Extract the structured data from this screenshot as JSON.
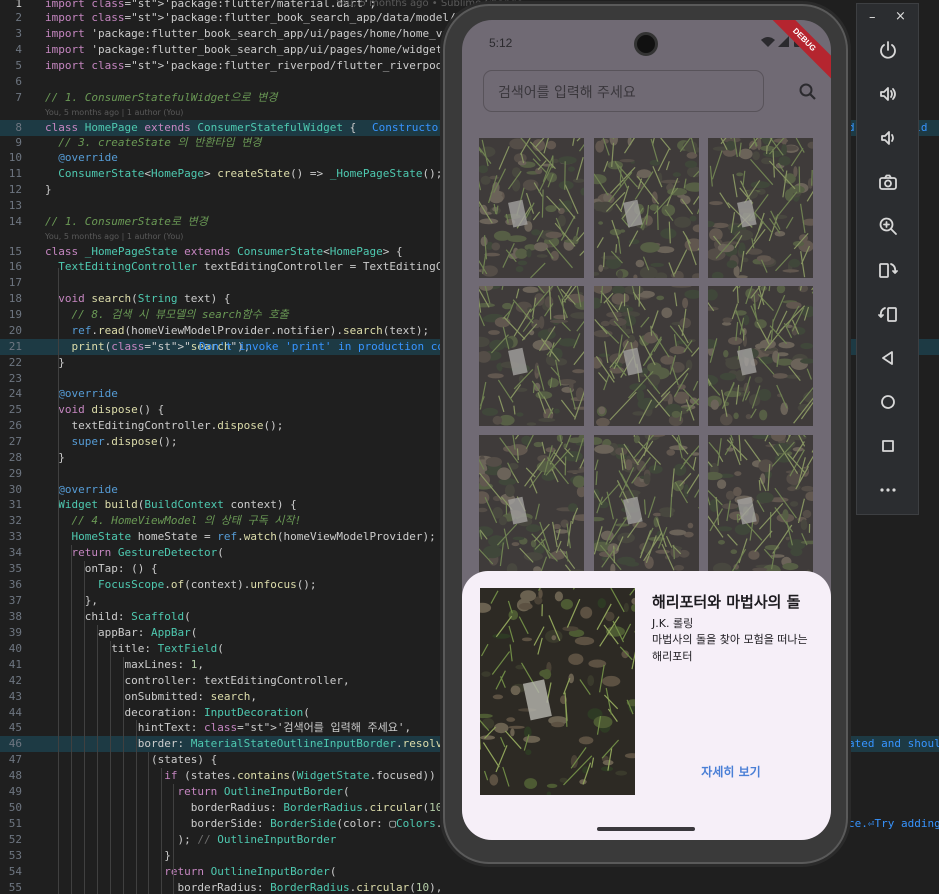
{
  "editor": {
    "blame_top": "You, 5 months ago • Sublime Change",
    "blame_8": "You, 5 months ago | 1 author (You)",
    "blame_15": "You, 5 months ago | 1 author (You)",
    "hint_8": "Constructor",
    "hint_8b": "d and should",
    "hint_21": "Don't invoke 'print' in production cod",
    "hint_46": "ated and should",
    "hint_51": "ce.⏎Try adding",
    "lines": [
      {
        "n": "1",
        "t": "import 'package:flutter/material.dart';"
      },
      {
        "n": "2",
        "t": "import 'package:flutter_book_search_app/data/model/book.dart';"
      },
      {
        "n": "3",
        "t": "import 'package:flutter_book_search_app/ui/pages/home/home_vie"
      },
      {
        "n": "4",
        "t": "import 'package:flutter_book_search_app/ui/pages/home/widgets/"
      },
      {
        "n": "5",
        "t": "import 'package:flutter_riverpod/flutter_riverpod.dart';"
      },
      {
        "n": "6",
        "t": ""
      },
      {
        "n": "7",
        "t": "// 1. ConsumerStatefulWidget으로 변경"
      },
      {
        "n": "8",
        "t": "class HomePage extends ConsumerStatefulWidget {"
      },
      {
        "n": "9",
        "t": "  // 3. createState 의 반환타입 변경"
      },
      {
        "n": "10",
        "t": "  @override"
      },
      {
        "n": "11",
        "t": "  ConsumerState<HomePage> createState() => _HomePageState();"
      },
      {
        "n": "12",
        "t": "}"
      },
      {
        "n": "13",
        "t": ""
      },
      {
        "n": "14",
        "t": "// 1. ConsumerState로 변경"
      },
      {
        "n": "15",
        "t": "class _HomePageState extends ConsumerState<HomePage> {"
      },
      {
        "n": "16",
        "t": "  TextEditingController textEditingController = TextEditingCon"
      },
      {
        "n": "17",
        "t": ""
      },
      {
        "n": "18",
        "t": "  void search(String text) {"
      },
      {
        "n": "19",
        "t": "    // 8. 검색 시 뷰모델의 search함수 호출"
      },
      {
        "n": "20",
        "t": "    ref.read(homeViewModelProvider.notifier).search(text);"
      },
      {
        "n": "21",
        "t": "    print(\"search\");"
      },
      {
        "n": "22",
        "t": "  }"
      },
      {
        "n": "23",
        "t": ""
      },
      {
        "n": "24",
        "t": "  @override"
      },
      {
        "n": "25",
        "t": "  void dispose() {"
      },
      {
        "n": "26",
        "t": "    textEditingController.dispose();"
      },
      {
        "n": "27",
        "t": "    super.dispose();"
      },
      {
        "n": "28",
        "t": "  }"
      },
      {
        "n": "29",
        "t": ""
      },
      {
        "n": "30",
        "t": "  @override"
      },
      {
        "n": "31",
        "t": "  Widget build(BuildContext context) {"
      },
      {
        "n": "32",
        "t": "    // 4. HomeViewModel 의 상태 구독 시작!"
      },
      {
        "n": "33",
        "t": "    HomeState homeState = ref.watch(homeViewModelProvider);"
      },
      {
        "n": "34",
        "t": "    return GestureDetector("
      },
      {
        "n": "35",
        "t": "      onTap: () {"
      },
      {
        "n": "36",
        "t": "        FocusScope.of(context).unfocus();"
      },
      {
        "n": "37",
        "t": "      },"
      },
      {
        "n": "38",
        "t": "      child: Scaffold("
      },
      {
        "n": "39",
        "t": "        appBar: AppBar("
      },
      {
        "n": "40",
        "t": "          title: TextField("
      },
      {
        "n": "41",
        "t": "            maxLines: 1,"
      },
      {
        "n": "42",
        "t": "            controller: textEditingController,"
      },
      {
        "n": "43",
        "t": "            onSubmitted: search,"
      },
      {
        "n": "44",
        "t": "            decoration: InputDecoration("
      },
      {
        "n": "45",
        "t": "              hintText: '검색어를 입력해 주세요',"
      },
      {
        "n": "46",
        "t": "              border: MaterialStateOutlineInputBorder.resolveWi"
      },
      {
        "n": "47",
        "t": "                (states) {"
      },
      {
        "n": "48",
        "t": "                  if (states.contains(WidgetState.focused)) {"
      },
      {
        "n": "49",
        "t": "                    return OutlineInputBorder("
      },
      {
        "n": "50",
        "t": "                      borderRadius: BorderRadius.circular(10),"
      },
      {
        "n": "51",
        "t": "                      borderSide: BorderSide(color: ▢Colors.b"
      },
      {
        "n": "52",
        "t": "                    ); // OutlineInputBorder"
      },
      {
        "n": "53",
        "t": "                  }"
      },
      {
        "n": "54",
        "t": "                  return OutlineInputBorder("
      },
      {
        "n": "55",
        "t": "                    borderRadius: BorderRadius.circular(10),"
      }
    ]
  },
  "phone": {
    "time": "5:12",
    "debug": "DEBUG",
    "search_placeholder": "검색어를 입력해 주세요",
    "sheet": {
      "title": "해리포터와 마법사의 돌",
      "author": "J.K. 롤링",
      "description": "마법사의 돌을 찾아 모험을 떠나는 해리포터",
      "detail_label": "자세히 보기"
    }
  },
  "toolbar": {
    "minimize": "–",
    "close": "×",
    "buttons": [
      "power-icon",
      "volume-up-icon",
      "volume-down-icon",
      "camera-icon",
      "zoom-in-icon",
      "rotate-right-icon",
      "rotate-left-icon",
      "back-icon",
      "home-icon",
      "overview-icon",
      "more-icon"
    ]
  },
  "colors": {
    "editor_bg": "#1f1f1f",
    "highlight": "#1d3a44",
    "sheet_bg": "#f6eff8",
    "detail_button": "#4a7fd6",
    "debug_banner": "#b5252f"
  }
}
